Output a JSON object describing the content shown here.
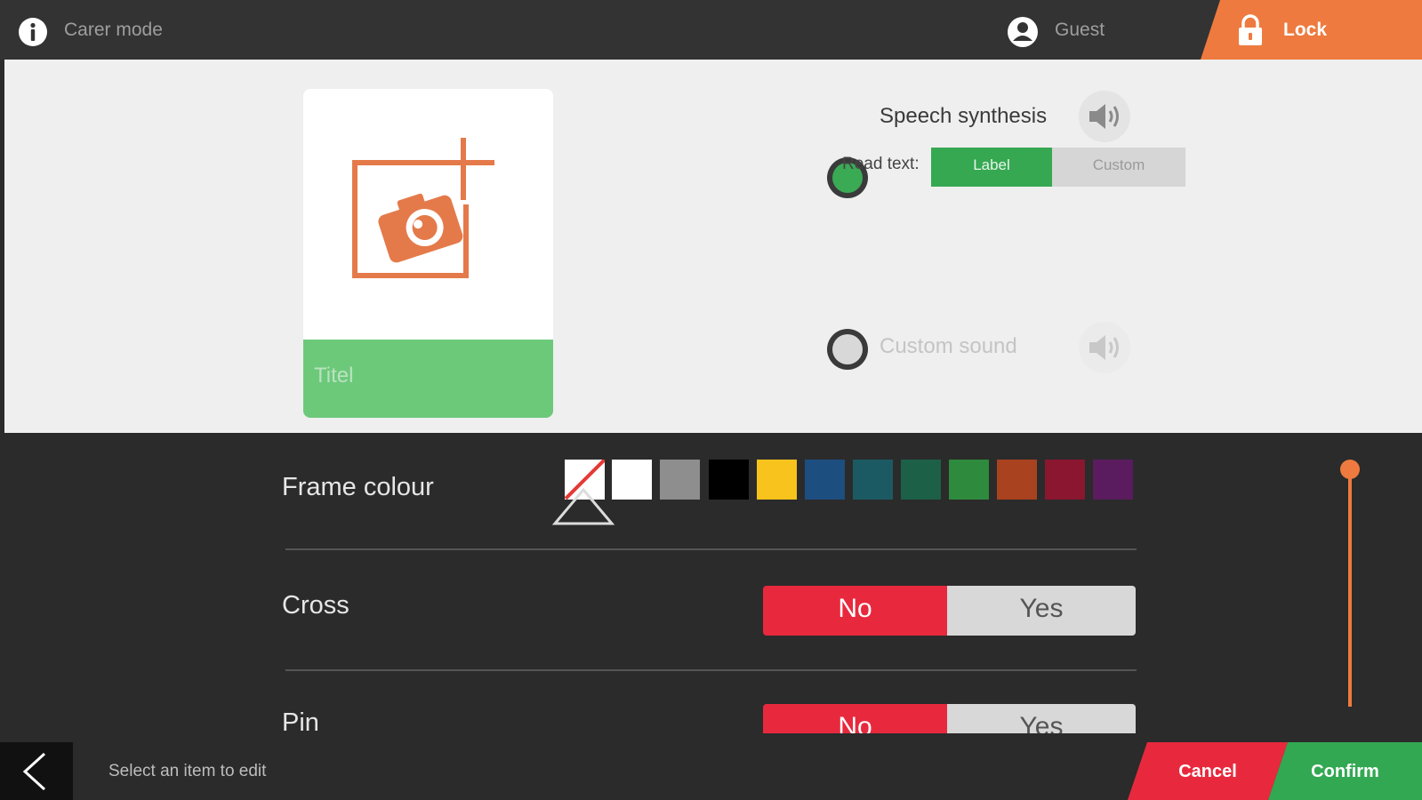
{
  "header": {
    "mode": "Carer mode",
    "user": "Guest",
    "lock_label": "Lock"
  },
  "card": {
    "label_placeholder": "Titel"
  },
  "audio": {
    "speech_synthesis_label": "Speech synthesis",
    "read_text_label": "Read text:",
    "read_text_options": [
      "Label",
      "Custom"
    ],
    "read_text_selected": "Label",
    "custom_sound_label": "Custom sound",
    "selected_option": "Speech synthesis"
  },
  "settings": {
    "frame_colour": {
      "label": "Frame colour",
      "selected": "none",
      "colors": [
        "none",
        "#ffffff",
        "#8e8e8e",
        "#000000",
        "#f7c31c",
        "#1d4e80",
        "#1c5a63",
        "#1c6048",
        "#2e8a3c",
        "#a9421f",
        "#8a1630",
        "#5a1c5e"
      ]
    },
    "cross": {
      "label": "Cross",
      "options": [
        "No",
        "Yes"
      ],
      "selected": "No"
    },
    "pin": {
      "label": "Pin",
      "options": [
        "No",
        "Yes"
      ],
      "selected": "No"
    }
  },
  "footer": {
    "hint": "Select an item to edit",
    "cancel_label": "Cancel",
    "confirm_label": "Confirm"
  },
  "colors": {
    "accent": "#ee7a3f",
    "green": "#33a852",
    "red": "#e8293d",
    "card_label_bg": "#6cc97a"
  },
  "icons": [
    "info-icon",
    "user-icon",
    "lock-icon",
    "add-photo-icon",
    "speaker-icon",
    "back-arrow-icon"
  ]
}
